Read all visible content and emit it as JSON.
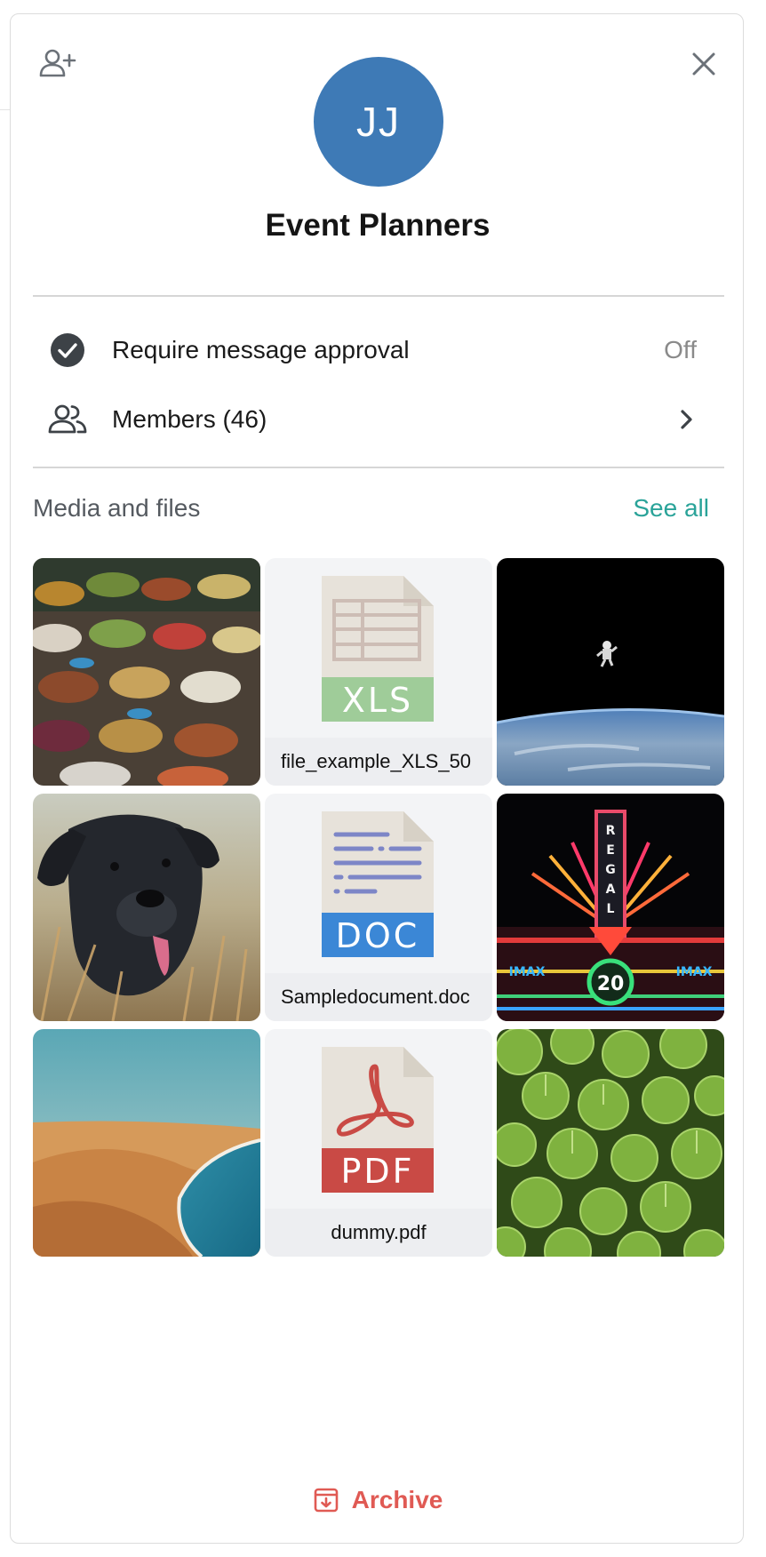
{
  "header": {
    "avatar_initials": "JJ",
    "group_name": "Event Planners",
    "avatar_color": "#3e7ab6",
    "add_member_icon": "person-add-icon",
    "close_icon": "close-icon"
  },
  "settings": {
    "approval": {
      "label": "Require message approval",
      "value": "Off",
      "icon": "check-circle-icon"
    },
    "members": {
      "label": "Members (46)",
      "icon": "group-icon",
      "trailing_icon": "chevron-right-icon"
    }
  },
  "media": {
    "title": "Media and files",
    "see_all": "See all",
    "accent": "#2aa399",
    "items": [
      {
        "kind": "image",
        "subject": "market stall with vegetables and spices"
      },
      {
        "kind": "file",
        "type": "XLS",
        "name": "file_example_XLS_50",
        "color": "#9fcc99"
      },
      {
        "kind": "image",
        "subject": "astronaut floating above Earth"
      },
      {
        "kind": "image",
        "subject": "black dog in tall grass"
      },
      {
        "kind": "file",
        "type": "DOC",
        "name": "Sampledocument.doc",
        "color": "#3b87d6"
      },
      {
        "kind": "image",
        "subject": "neon Regal IMAX theater sign"
      },
      {
        "kind": "image",
        "subject": "sand dunes meeting the ocean"
      },
      {
        "kind": "file",
        "type": "PDF",
        "name": "dummy.pdf",
        "color": "#c94a45"
      },
      {
        "kind": "image",
        "subject": "green pennywort leaves"
      }
    ]
  },
  "footer": {
    "archive_label": "Archive",
    "archive_icon": "archive-icon",
    "archive_color": "#e05a54"
  }
}
